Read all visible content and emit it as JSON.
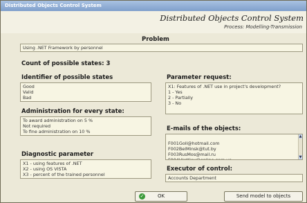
{
  "window": {
    "title": "Distributed Objects Control System"
  },
  "header": {
    "app_title": "Distributed Objects Control System",
    "subtitle": "Process: Modelling-Transmission"
  },
  "problem": {
    "label": "Problem",
    "value": "Using .NET Framework by personnel"
  },
  "states": {
    "count_text": "Count of possible states: 3",
    "identifier_label": "Identifier of possible states",
    "identifier_values": "Good\nValid\nBad",
    "administration_label": "Administration for every state:",
    "administration_values": "To award administration on 5 %\nNot required\nTo fine administration on 10 %"
  },
  "diagnostic": {
    "label": "Diagnostic parameter",
    "values": "X1 - using features of .NET\nX2 - using OS VISTA\nX3 - percent of the trained personnel"
  },
  "parameter_request": {
    "label": "Parameter request:",
    "values": "X1: Features of .NET use in project's development?\n1 - Yes\n2 - Partially\n3 - No"
  },
  "emails": {
    "label": "E-mails of the objects:",
    "values": "F001Goll@hotmail.com\nF002BelMinsk@tut.by\nF003RusMos@mail.ru\nF004UkrKiev@online.com.ua"
  },
  "executor": {
    "label": "Executor of control:",
    "value": "Accounts Department"
  },
  "buttons": {
    "ok_label": "OK",
    "send_label": "Send model to objects"
  }
}
